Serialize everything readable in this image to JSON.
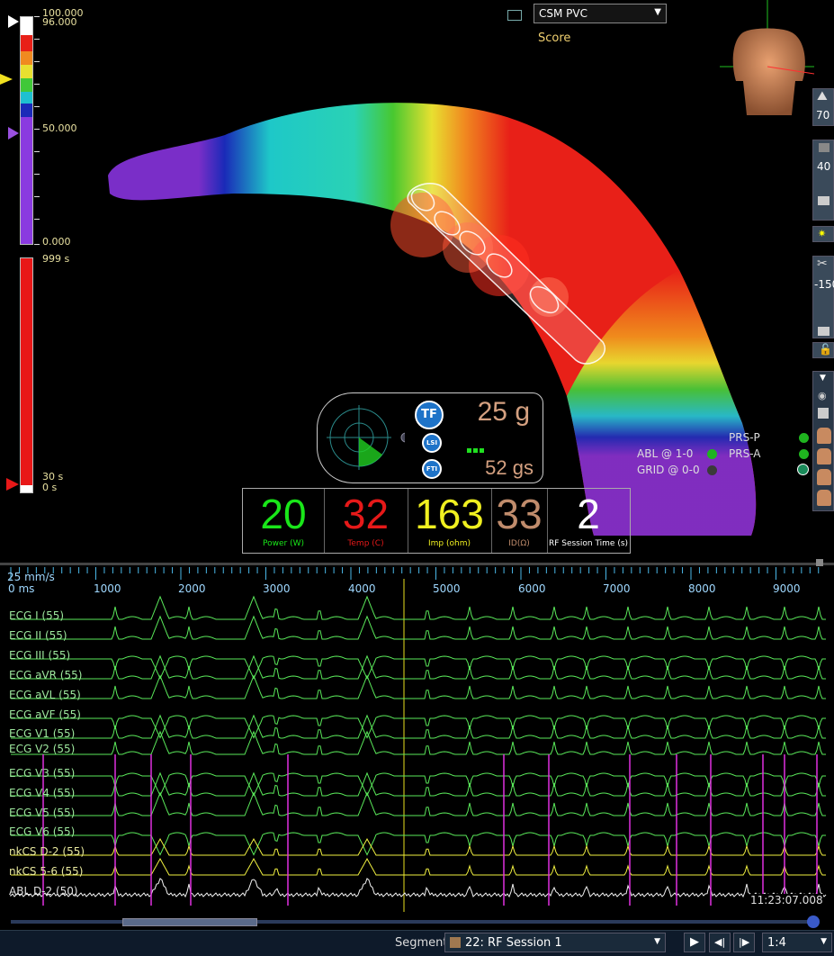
{
  "map_dropdown": {
    "selected": "CSM PVC",
    "sublabel": "Score"
  },
  "scale_top": {
    "max": "100.000",
    "upper": "96.000",
    "mid": "50.000",
    "min": "0.000"
  },
  "scale_bottom": {
    "max": "999 s",
    "mark": "30 s",
    "min": "0 s"
  },
  "right_toolbar": {
    "peak_value": "70",
    "opacity_value": "40",
    "clip_value": "-150"
  },
  "catheter_widget": {
    "tf": "TF",
    "lsi": "LSI",
    "fti": "FTI",
    "force": "25 g",
    "fti_value": "52 gs"
  },
  "electrodes": {
    "abl": "ABL @ 1-0",
    "grid": "GRID @ 0-0",
    "prs_p": "PRS-P",
    "prs_a": "PRS-A",
    "colors": {
      "abl": "#1fb41f",
      "grid": "#3a3a3a",
      "prs_p": "#1fb41f",
      "prs_a": "#1fb41f"
    }
  },
  "metrics": [
    {
      "value": "20",
      "label": "Power (W)",
      "color": "#19e619"
    },
    {
      "value": "32",
      "label": "Temp (C)",
      "color": "#e61919"
    },
    {
      "value": "163",
      "label": "Imp (ohm)",
      "color": "#f0f020"
    },
    {
      "value": "33",
      "label": "ID(Ω)",
      "color": "#c08c6c"
    },
    {
      "value": "2",
      "label": "RF Session Time (s)",
      "color": "#ffffff"
    }
  ],
  "timeline": {
    "speed": "25 mm/s",
    "ticks": [
      "0 ms",
      "1000",
      "2000",
      "3000",
      "4000",
      "5000",
      "6000",
      "7000",
      "8000",
      "9000"
    ]
  },
  "channels": [
    "ECG I (55)",
    "ECG II (55)",
    "ECG III (55)",
    "ECG aVR (55)",
    "ECG aVL (55)",
    "ECG aVF (55)",
    "ECG V1 (55)",
    "ECG V2 (55)",
    "ECG V3 (55)",
    "ECG V4 (55)",
    "ECG V5 (55)",
    "ECG V6 (55)",
    "nkCS   D-2 (55)",
    "nkCS   5-6 (55)",
    "ABL   D-2 (50)"
  ],
  "timestamp": "11:23:07.008",
  "bottom_bar": {
    "segment_label": "Segment",
    "segment_value": "22: RF Session 1",
    "speed_value": "1:4"
  }
}
